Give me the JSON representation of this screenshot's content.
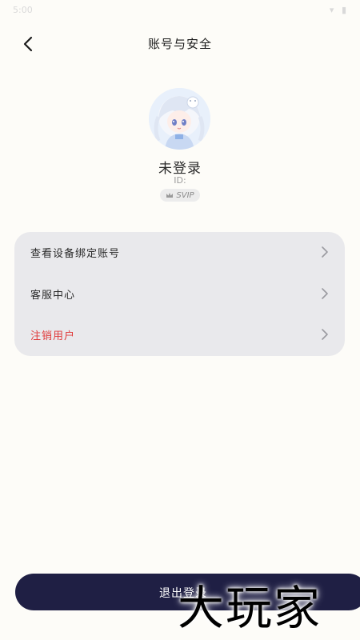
{
  "status_bar": {
    "time": "5:00",
    "icons": "▾ ▮"
  },
  "nav": {
    "title": "账号与安全",
    "back_icon": "chevron-left-icon"
  },
  "profile": {
    "name": "未登录",
    "id_label": "ID:",
    "id_value": "",
    "badge": {
      "text": "SVIP",
      "icon": "crown-icon"
    },
    "avatar": "anime-girl-avatar"
  },
  "menu": {
    "items": [
      {
        "label": "查看设备绑定账号",
        "chevron": "chevron-right-icon"
      },
      {
        "label": "客服中心",
        "chevron": "chevron-right-icon"
      },
      {
        "label": "注销用户",
        "chevron": "chevron-right-icon"
      }
    ]
  },
  "logout": {
    "label": "退出登录"
  },
  "watermark": {
    "text": "大玩家"
  },
  "colors": {
    "background": "#fdfcf8",
    "card": "#e9e9ec",
    "danger": "#e03a3a",
    "logout_bg": "#1f1f44"
  }
}
